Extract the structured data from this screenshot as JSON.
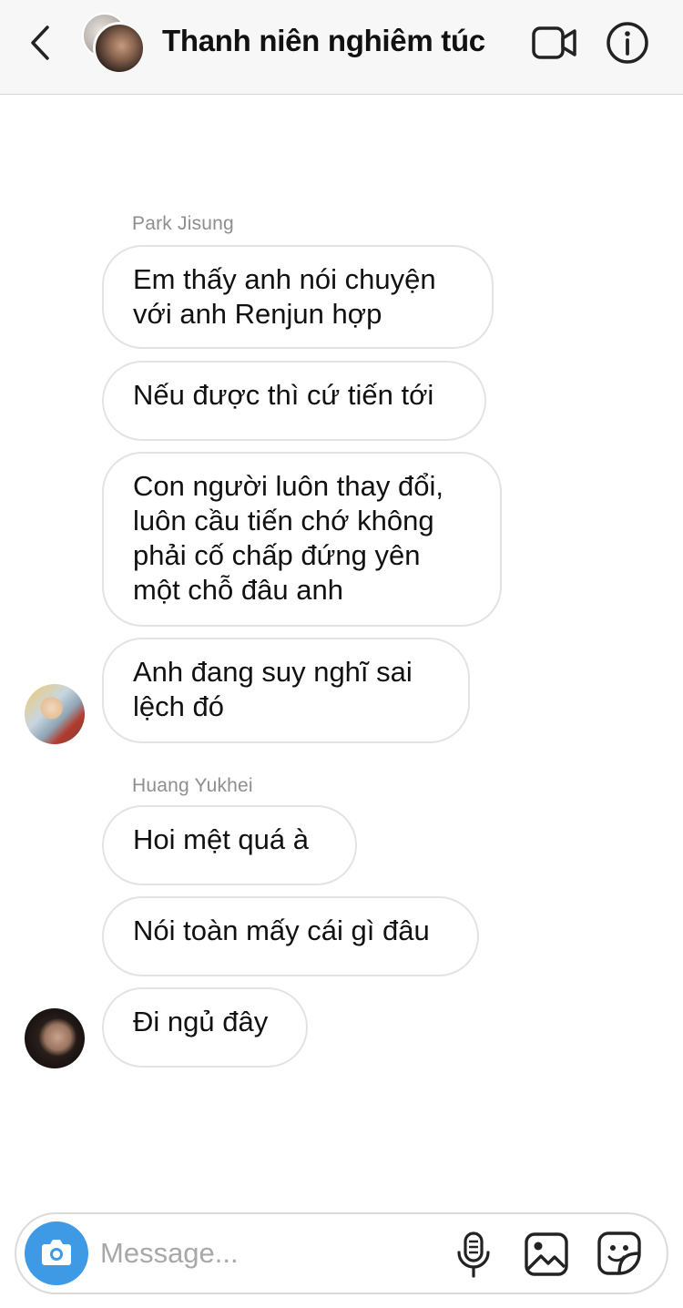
{
  "header": {
    "title": "Thanh niên nghiêm túc",
    "back_icon": "chevron-left-icon",
    "video_icon": "video-camera-icon",
    "info_icon": "info-icon"
  },
  "messages": [
    {
      "sender": "Park Jisung",
      "bubbles": [
        "Em thấy anh nói chuyện\nvới anh Renjun hợp",
        "Nếu được thì cứ tiến tới",
        "Con người luôn thay đổi,\nluôn cầu tiến chớ không\nphải cố chấp đứng yên\nmột chỗ đâu anh",
        "Anh đang suy nghĩ sai\nlệch đó"
      ]
    },
    {
      "sender": "Huang Yukhei",
      "bubbles": [
        "Hoi mệt quá à",
        "Nói toàn mấy cái gì đâu",
        "Đi ngủ đây"
      ]
    }
  ],
  "composer": {
    "placeholder": "Message...",
    "camera_icon": "camera-icon",
    "mic_icon": "microphone-icon",
    "gallery_icon": "image-icon",
    "sticker_icon": "sticker-icon",
    "accent_color": "#3f9ae6"
  }
}
